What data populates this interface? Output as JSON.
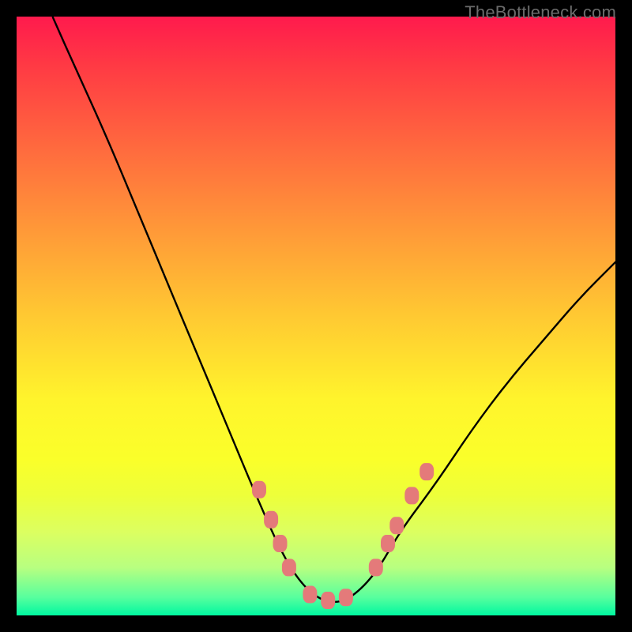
{
  "watermark": "TheBottleneck.com",
  "chart_data": {
    "type": "line",
    "title": "",
    "xlabel": "",
    "ylabel": "",
    "xlim": [
      0,
      100
    ],
    "ylim": [
      0,
      100
    ],
    "series": [
      {
        "name": "bottleneck-curve",
        "x": [
          6,
          10,
          15,
          20,
          25,
          30,
          35,
          40,
          44,
          47,
          50,
          53,
          56,
          60,
          64,
          70,
          76,
          82,
          88,
          94,
          100
        ],
        "y": [
          100,
          91,
          80,
          68,
          56,
          44,
          32,
          20,
          11,
          6,
          3,
          2,
          3,
          7,
          14,
          22,
          31,
          39,
          46,
          53,
          59
        ]
      }
    ],
    "markers": [
      {
        "name": "left-marker",
        "x": 40.5,
        "y": 21
      },
      {
        "name": "left-marker",
        "x": 42.5,
        "y": 16
      },
      {
        "name": "left-marker",
        "x": 44.0,
        "y": 12
      },
      {
        "name": "left-marker",
        "x": 45.5,
        "y": 8
      },
      {
        "name": "bottom-marker",
        "x": 49.0,
        "y": 3.5
      },
      {
        "name": "bottom-marker",
        "x": 52.0,
        "y": 2.5
      },
      {
        "name": "bottom-marker",
        "x": 55.0,
        "y": 3.0
      },
      {
        "name": "right-marker",
        "x": 60.0,
        "y": 8
      },
      {
        "name": "right-marker",
        "x": 62.0,
        "y": 12
      },
      {
        "name": "right-marker",
        "x": 63.5,
        "y": 15
      },
      {
        "name": "right-marker",
        "x": 66.0,
        "y": 20
      },
      {
        "name": "right-marker",
        "x": 68.5,
        "y": 24
      }
    ],
    "marker_color": "#e47a7a"
  }
}
